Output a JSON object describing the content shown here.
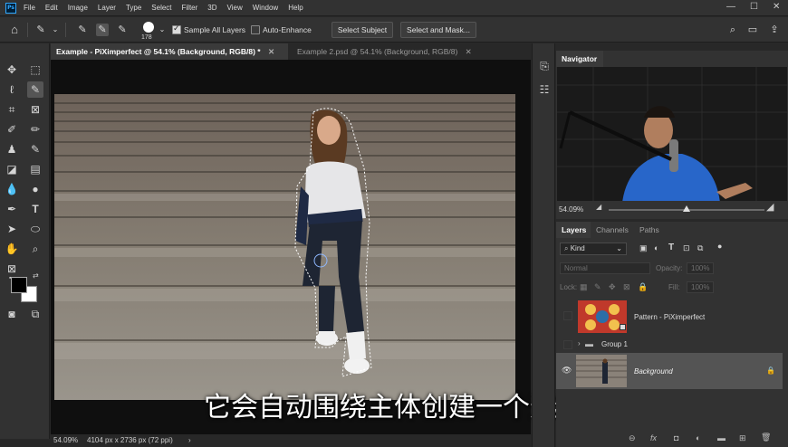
{
  "menu": {
    "logo": "Ps",
    "items": [
      "File",
      "Edit",
      "Image",
      "Layer",
      "Type",
      "Select",
      "Filter",
      "3D",
      "View",
      "Window",
      "Help"
    ],
    "window_controls": [
      "—",
      "☐",
      "✕"
    ]
  },
  "options": {
    "brush_size": "178",
    "sample_all_layers_label": "Sample All Layers",
    "sample_all_layers_checked": true,
    "auto_enhance_label": "Auto-Enhance",
    "auto_enhance_checked": false,
    "select_subject_label": "Select Subject",
    "select_and_mask_label": "Select and Mask..."
  },
  "tabs": [
    {
      "label": "Example - PiXimperfect @ 54.1% (Background, RGB/8) *",
      "close": "✕",
      "active": true
    },
    {
      "label": "Example 2.psd @ 54.1% (Background, RGB/8)",
      "close": "✕",
      "active": false
    }
  ],
  "status": {
    "zoom": "54.09%",
    "doc_info": "4104 px x 2736 px (72 ppi)",
    "arrow": "›"
  },
  "subtitle": "它会自动围绕主体创建一个选区",
  "navigator": {
    "tab_label": "Navigator",
    "zoom": "54.09%",
    "zoom_slider_fraction": 0.5
  },
  "layers": {
    "tabs": [
      "Layers",
      "Channels",
      "Paths"
    ],
    "filter_kind": "Kind",
    "blend_mode": "Normal",
    "opacity_label": "Opacity:",
    "opacity_value": "100%",
    "lock_label": "Lock:",
    "fill_label": "Fill:",
    "fill_value": "100%",
    "items": [
      {
        "name": "Pattern - PiXimperfect",
        "type": "pattern",
        "visible": false
      },
      {
        "name": "Group 1",
        "type": "group",
        "visible": false
      },
      {
        "name": "Background",
        "type": "background",
        "visible": true
      }
    ],
    "footer_icons": [
      "link-icon",
      "fx-icon",
      "mask-icon",
      "adjustment-icon",
      "folder-icon",
      "new-layer-icon",
      "trash-icon"
    ],
    "footer_glyphs": [
      "⊖",
      "fx",
      "◘",
      "◐",
      "▬",
      "⊞",
      "🗑"
    ]
  },
  "colors": {
    "accent": "#31a8ff",
    "panel_bg": "#323232",
    "selected_layer": "#545454"
  }
}
